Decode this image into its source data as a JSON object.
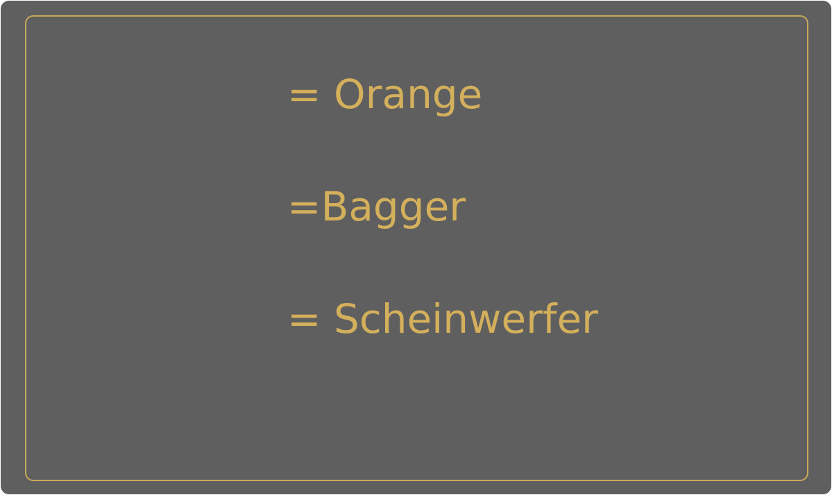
{
  "colors": {
    "background": "#5f5f5f",
    "accent": "#d4b05c",
    "frame": "#c9a95a"
  },
  "lines": [
    {
      "text": "= Orange"
    },
    {
      "text": "=Bagger"
    },
    {
      "text": "= Scheinwerfer"
    }
  ]
}
